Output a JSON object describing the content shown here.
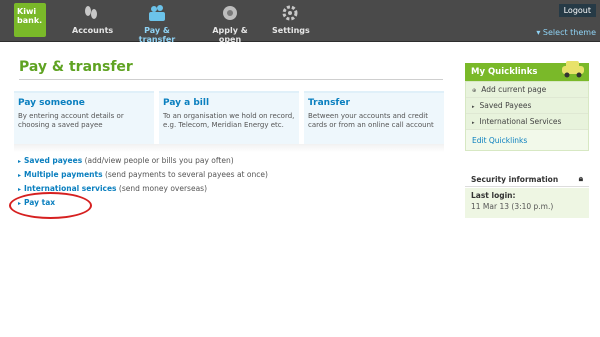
{
  "logo": {
    "line1": "Kiwi",
    "line2": "bank."
  },
  "nav": [
    {
      "label": "Accounts",
      "icon": "footprints-icon"
    },
    {
      "label": "Pay & transfer",
      "icon": "transfer-icon"
    },
    {
      "label": "Apply & open",
      "icon": "apply-icon"
    },
    {
      "label": "Settings",
      "icon": "gear-icon"
    }
  ],
  "header": {
    "logout": "Logout",
    "select_theme": "Select theme"
  },
  "main": {
    "title": "Pay & transfer",
    "cards": [
      {
        "title": "Pay someone",
        "desc": "By entering account details or choosing a saved payee"
      },
      {
        "title": "Pay a bill",
        "desc": "To an organisation we hold on record, e.g. Telecom, Meridian Energy etc."
      },
      {
        "title": "Transfer",
        "desc": "Between your accounts and credit cards or from an online call account"
      }
    ],
    "links": [
      {
        "label": "Saved payees",
        "desc": "(add/view people or bills you pay often)"
      },
      {
        "label": "Multiple payments",
        "desc": "(send payments to several payees at once)"
      },
      {
        "label": "International services",
        "desc": "(send money overseas)"
      },
      {
        "label": "Pay tax",
        "desc": ""
      }
    ]
  },
  "sidebar": {
    "quicklinks_title": "My Quicklinks",
    "items": [
      "Add current page",
      "Saved Payees",
      "International Services"
    ],
    "edit": "Edit Quicklinks",
    "security_title": "Security information",
    "last_login_label": "Last login:",
    "last_login_value": "11 Mar 13 (3:10 p.m.)"
  },
  "colors": {
    "brand_green": "#7ab929",
    "link_blue": "#0a7fbf",
    "nav_bg": "#4a4a4a",
    "annotation_red": "#d62020"
  }
}
